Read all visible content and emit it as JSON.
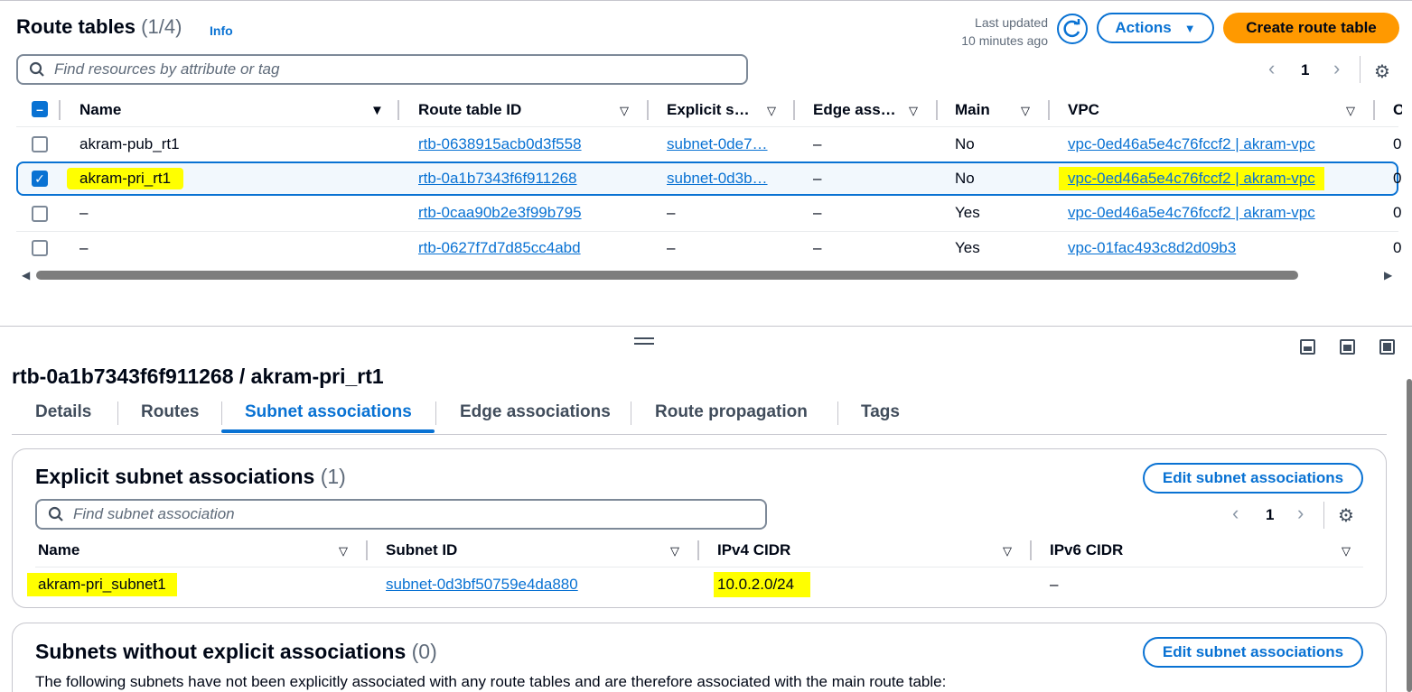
{
  "route_tables": {
    "title": "Route tables",
    "count": "(1/4)",
    "info": "Info",
    "last_updated_label": "Last updated",
    "last_updated_value": "10 minutes ago",
    "actions_label": "Actions",
    "create_label": "Create route table",
    "search_placeholder": "Find resources by attribute or tag",
    "page": "1",
    "columns": [
      "Name",
      "Route table ID",
      "Explicit s…",
      "Edge ass…",
      "Main",
      "VPC",
      "O"
    ],
    "rows": [
      {
        "name": "akram-pub_rt1",
        "id": "rtb-0638915acb0d3f558",
        "explicit": "subnet-0de7…",
        "edge": "–",
        "main": "No",
        "vpc": "vpc-0ed46a5e4c76fccf2 | akram-vpc",
        "owner": "0",
        "selected": false
      },
      {
        "name": "akram-pri_rt1",
        "id": "rtb-0a1b7343f6f911268",
        "explicit": "subnet-0d3b…",
        "edge": "–",
        "main": "No",
        "vpc": "vpc-0ed46a5e4c76fccf2 | akram-vpc",
        "owner": "0",
        "selected": true
      },
      {
        "name": "–",
        "id": "rtb-0caa90b2e3f99b795",
        "explicit": "–",
        "edge": "–",
        "main": "Yes",
        "vpc": "vpc-0ed46a5e4c76fccf2 | akram-vpc",
        "owner": "0",
        "selected": false
      },
      {
        "name": "–",
        "id": "rtb-0627f7d7d85cc4abd",
        "explicit": "–",
        "edge": "–",
        "main": "Yes",
        "vpc": "vpc-01fac493c8d2d09b3",
        "owner": "0",
        "selected": false
      }
    ]
  },
  "details": {
    "heading": "rtb-0a1b7343f6f911268 / akram-pri_rt1",
    "tabs": [
      "Details",
      "Routes",
      "Subnet associations",
      "Edge associations",
      "Route propagation",
      "Tags"
    ],
    "active_tab": "Subnet associations",
    "explicit": {
      "title": "Explicit subnet associations",
      "count": "(1)",
      "edit_label": "Edit subnet associations",
      "search_placeholder": "Find subnet association",
      "page": "1",
      "columns": [
        "Name",
        "Subnet ID",
        "IPv4 CIDR",
        "IPv6 CIDR"
      ],
      "rows": [
        {
          "name": "akram-pri_subnet1",
          "subnet_id": "subnet-0d3bf50759e4da880",
          "ipv4": "10.0.2.0/24",
          "ipv6": "–"
        }
      ]
    },
    "without": {
      "title": "Subnets without explicit associations",
      "count": "(0)",
      "edit_label": "Edit subnet associations",
      "description": "The following subnets have not been explicitly associated with any route tables and are therefore associated with the main route table:"
    }
  },
  "colors": {
    "accent": "#0972d3",
    "primary_button": "#ff9900",
    "highlight": "#ffff00"
  }
}
